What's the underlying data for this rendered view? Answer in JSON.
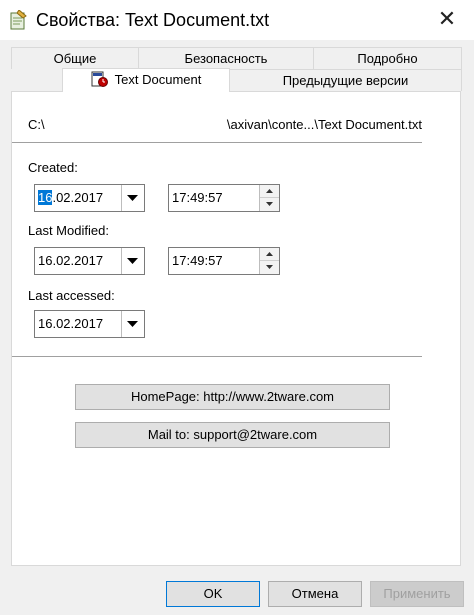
{
  "window": {
    "title": "Свойства: Text Document.txt",
    "close_glyph": "✕"
  },
  "tabs": {
    "row1": [
      "Общие",
      "Безопасность",
      "Подробно"
    ],
    "row2": {
      "active_label": "Text Document",
      "active_icon": "document-clock-icon",
      "other": "Предыдущие версии"
    }
  },
  "file": {
    "path_start": "C:\\",
    "path_end": "\\axivan\\conte...\\Text Document.txt"
  },
  "dates": {
    "created": {
      "label": "Created:",
      "date_selected_part": "16",
      "date_rest": ".02.2017",
      "time": "17:49:57"
    },
    "modified": {
      "label": "Last Modified:",
      "date": "16.02.2017",
      "time": "17:49:57"
    },
    "accessed": {
      "label": "Last accessed:",
      "date": "16.02.2017"
    }
  },
  "links": {
    "homepage": "HomePage: http://www.2tware.com",
    "mail": "Mail to: support@2tware.com"
  },
  "footer": {
    "ok": "OK",
    "cancel": "Отмена",
    "apply": "Применить"
  },
  "colors": {
    "selection": "#0078d7",
    "dialog_bg": "#f0f0f0",
    "panel_bg": "#ffffff"
  }
}
